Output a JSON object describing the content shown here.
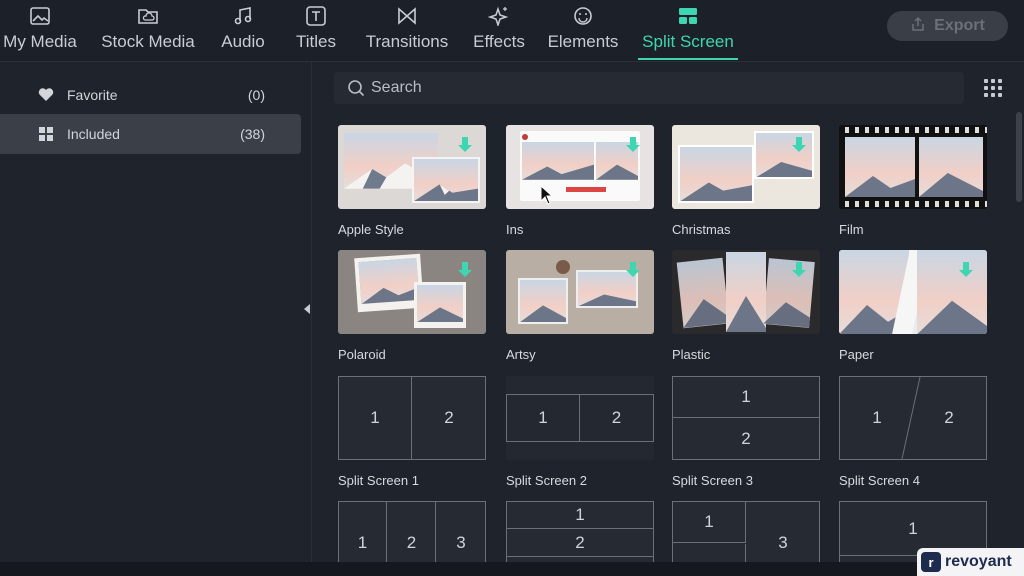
{
  "tabs": [
    {
      "label": "My Media",
      "icon": "image-icon"
    },
    {
      "label": "Stock Media",
      "icon": "cloud-folder-icon"
    },
    {
      "label": "Audio",
      "icon": "music-note-icon"
    },
    {
      "label": "Titles",
      "icon": "text-box-icon"
    },
    {
      "label": "Transitions",
      "icon": "bowtie-icon"
    },
    {
      "label": "Effects",
      "icon": "sparkle-icon"
    },
    {
      "label": "Elements",
      "icon": "smiley-icon"
    },
    {
      "label": "Split Screen",
      "icon": "split-layout-icon",
      "active": true
    }
  ],
  "export": {
    "label": "Export",
    "icon": "share-icon"
  },
  "sidebar": {
    "items": [
      {
        "label": "Favorite",
        "count": "(0)",
        "icon": "heart-icon"
      },
      {
        "label": "Included",
        "count": "(38)",
        "icon": "grid-icon",
        "active": true
      }
    ]
  },
  "search": {
    "placeholder": "Search"
  },
  "templates": [
    {
      "label": "Apple Style"
    },
    {
      "label": "Ins"
    },
    {
      "label": "Christmas"
    },
    {
      "label": "Film"
    },
    {
      "label": "Polaroid"
    },
    {
      "label": "Artsy"
    },
    {
      "label": "Plastic"
    },
    {
      "label": "Paper"
    },
    {
      "label": "Split Screen 1",
      "cells": [
        "1",
        "2"
      ]
    },
    {
      "label": "Split Screen 2",
      "cells": [
        "1",
        "2"
      ]
    },
    {
      "label": "Split Screen 3",
      "cells": [
        "1",
        "2"
      ]
    },
    {
      "label": "Split Screen 4",
      "cells": [
        "1",
        "2"
      ]
    },
    {
      "cells": [
        "1",
        "2",
        "3"
      ]
    },
    {
      "cells": [
        "1",
        "2"
      ]
    },
    {
      "cells": [
        "1",
        "3"
      ]
    },
    {
      "cells": [
        "1"
      ]
    }
  ],
  "watermark": {
    "logo": "r",
    "text": "revoyant"
  },
  "colors": {
    "accent": "#3ed6b0",
    "background": "#1f232b",
    "active_item": "#3a3f48"
  }
}
